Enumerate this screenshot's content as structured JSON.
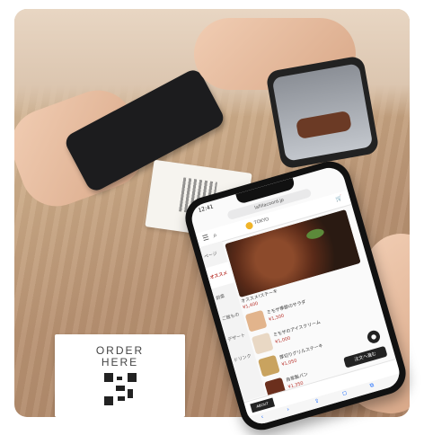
{
  "order_card": {
    "line1": "ORDER",
    "line2": "HERE"
  },
  "phone": {
    "url": "lafillacoord.jp",
    "status_time": "12:41",
    "shop_name": "TOKYO",
    "cart_label": "カート",
    "icons": {
      "menu": "menu-icon",
      "search": "search-icon",
      "cart": "cart-icon"
    },
    "categories": [
      {
        "label": "ページ"
      },
      {
        "label": "オススメ",
        "active": true
      },
      {
        "label": "前菜"
      },
      {
        "label": "ご飯もの"
      },
      {
        "label": "デザート"
      },
      {
        "label": "ドリンク"
      }
    ],
    "hero": {
      "caption": "オススメ!ステーキ",
      "price": "¥1,400"
    },
    "items": [
      {
        "name": "ミモザ季節のサラダ",
        "price": "¥1,300",
        "color": "#e2b48c"
      },
      {
        "name": "ミモザのアイスクリーム",
        "price": "¥1,000",
        "color": "#e9d8c4"
      },
      {
        "name": "厚切りグリルステーキ",
        "price": "¥1,050",
        "color": "#c9a35f"
      },
      {
        "name": "自家製パン",
        "price": "¥1,350",
        "color": "#6b2f1d"
      }
    ],
    "order_button": "注文へ進む",
    "bottom_tag": "ABOUT",
    "nav_icons": [
      "‹",
      "›",
      "⇪",
      "◻",
      "⧉"
    ]
  },
  "colors": {
    "accent": "#b8322b",
    "dark": "#222222"
  }
}
